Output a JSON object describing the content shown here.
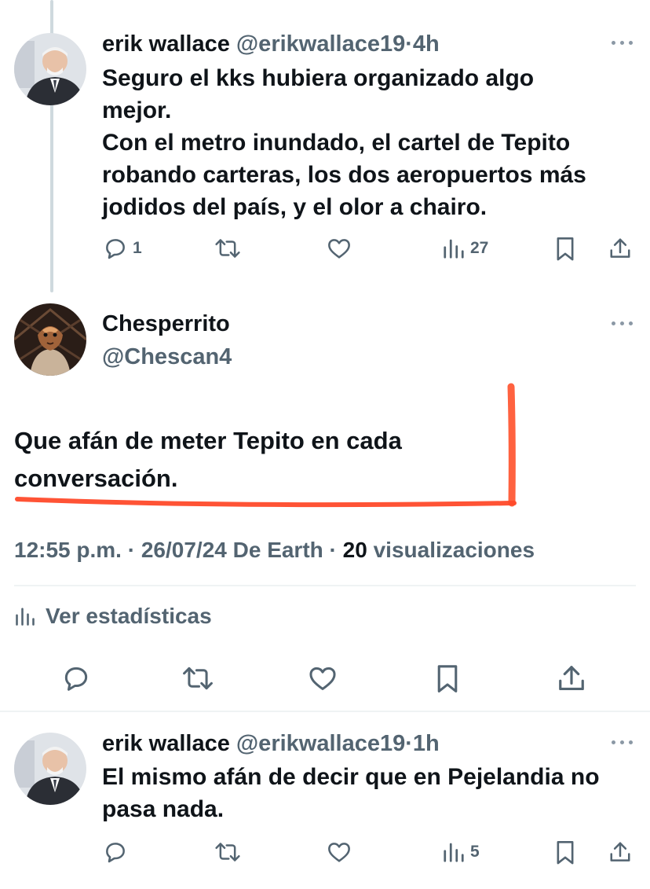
{
  "tweets": [
    {
      "name": "erik wallace",
      "handle": "@erikwallace19",
      "sep": "·",
      "time": "4h",
      "lines": [
        "Seguro el kks hubiera organizado algo",
        "mejor.",
        "Con el metro inundado, el cartel de Tepito",
        "robando carteras, los dos aeropuertos más",
        "jodidos del país, y el olor a chairo."
      ],
      "replies": "1",
      "views": "27"
    },
    {
      "name": "erik wallace",
      "handle": "@erikwallace19",
      "sep": "·",
      "time": "1h",
      "lines": [
        "El mismo afán de decir que en Pejelandia no",
        "pasa nada."
      ],
      "views": "5"
    }
  ],
  "main_tweet": {
    "name": "Chesperrito",
    "handle": "@Chescan4",
    "lines": [
      "Que afán de meter Tepito en cada",
      "conversación."
    ],
    "time": "12:55 p.m.",
    "sep1": "·",
    "date_source": "26/07/24 De Earth",
    "sep2": "·",
    "views_count": "20",
    "views_label": "visualizaciones",
    "stats_link": "Ver estadísticas"
  },
  "colors": {
    "accent_red": "#ff5a36",
    "muted": "#536471",
    "divider": "#eff3f4"
  },
  "icons": [
    "reply-icon",
    "retweet-icon",
    "like-icon",
    "views-icon",
    "bookmark-icon",
    "share-icon",
    "more-icon"
  ]
}
